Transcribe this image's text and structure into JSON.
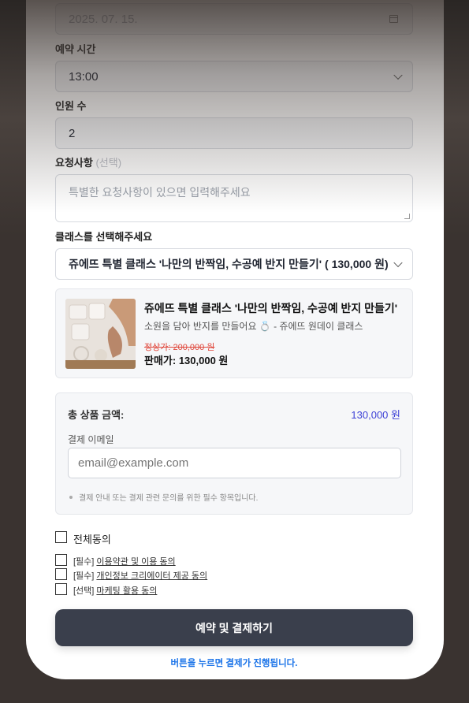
{
  "form": {
    "date_value": "2025. 07. 15.",
    "time_label": "예약 시간",
    "time_value": "13:00",
    "people_label": "인원 수",
    "people_value": "2",
    "request_label": "요청사항",
    "request_optional": "(선택)",
    "request_placeholder": "특별한 요청사항이 있으면 입력해주세요",
    "class_label": "클래스를 선택해주세요",
    "class_value": "쥬에뜨 특별 클래스 '나만의 반짝임, 수공예 반지 만들기' ( 130,000 원)"
  },
  "product": {
    "title": "쥬에뜨 특별 클래스 '나만의 반짝임, 수공예 반지 만들기'",
    "desc": "소원을 담아 반지를 만들어요 💍 - 쥬에뜨 원데이 클래스",
    "original_price": "정상가: 200,000 원",
    "sale_price": "판매가: 130,000 원",
    "image_icon": "ring-craft-photo"
  },
  "summary": {
    "total_label": "총 상품 금액:",
    "total_value": "130,000 원",
    "email_label": "결제 이메일",
    "email_placeholder": "email@example.com",
    "note": "결제 안내 또는 결제 관련 문의를 위한 필수 항목입니다."
  },
  "agree": {
    "all_label": "전체동의",
    "items": [
      {
        "prefix": "[필수]",
        "link": "이용약관 및 이용 동의"
      },
      {
        "prefix": "[필수]",
        "link": "개인정보 크리에이터 제공 동의"
      },
      {
        "prefix": "[선택]",
        "link": "마케팅 활용 동의"
      }
    ]
  },
  "cta": {
    "label": "예약 및 결제하기",
    "hint": "버튼을 누르면 결제가 진행됩니다."
  },
  "colors": {
    "accent": "#3b3fd6",
    "hint": "#1a73e8",
    "strike": "#e0463a",
    "button": "#3a3f4c"
  }
}
